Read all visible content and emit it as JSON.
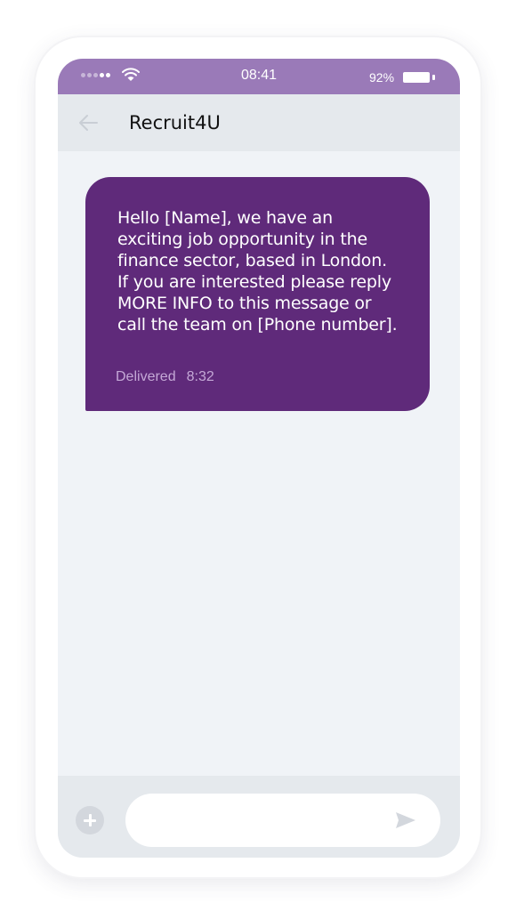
{
  "status_bar": {
    "time": "08:41",
    "battery_percent": "92%",
    "battery_level": 0.92,
    "signal_dots": 5,
    "signal_filled": 2,
    "icons": [
      "signal-icon",
      "wifi-icon",
      "battery-icon"
    ]
  },
  "header": {
    "contact_name": "Recruit4U",
    "back_icon": "back-arrow-icon"
  },
  "message": {
    "text": "Hello [Name], we have an\nexciting job opportunity in the\nfinance sector, based in London.\nIf you are interested please reply\nMORE INFO to this message or\ncall the team on [Phone number].",
    "status": "Delivered",
    "time": "8:32"
  },
  "composer": {
    "placeholder": "",
    "add_icon": "plus-icon",
    "send_icon": "send-icon"
  },
  "colors": {
    "status_bar": "#9a7ab8",
    "bubble": "#5f2a7a",
    "delivered_text": "#c4a8d6",
    "screen_bg": "#f0f3f7",
    "header_bg": "#e5e9ed"
  }
}
